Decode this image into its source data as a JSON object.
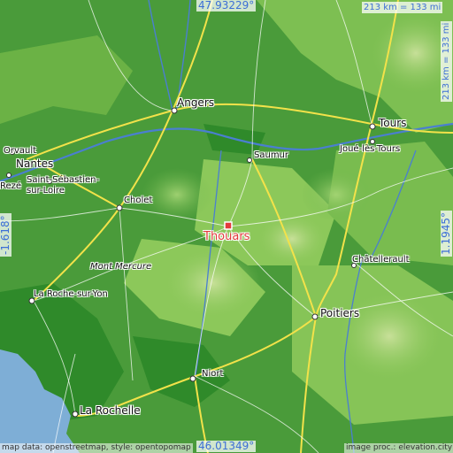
{
  "map": {
    "coordinates": {
      "north": "47.93229°",
      "south": "46.01349°",
      "west": "-1.618°",
      "east": "1.1945°"
    },
    "scale": {
      "horizontal": "213 km = 133 mi",
      "vertical": "213 km = 133 mi"
    },
    "focus_city": "Thouars",
    "places": {
      "angers": "Angers",
      "tours": "Tours",
      "joue_les_tours": "Joué-lès-Tours",
      "saumur": "Saumur",
      "orvault": "Orvault",
      "nantes": "Nantes",
      "reze": "Rezé",
      "saint_sebastien_line1": "Saint-Sébastien-",
      "saint_sebastien_line2": "sur-Loire",
      "cholet": "Cholet",
      "mont_mercure": "Mont Mercure",
      "chatellerault": "Châtellerault",
      "la_roche_sur_yon": "La Roche-sur-Yon",
      "poitiers": "Poitiers",
      "niort": "Niort",
      "la_rochelle": "La Rochelle"
    },
    "footer": {
      "left": "map data: openstreetmap, style: opentopomap",
      "right": "image proc.: elevation.city"
    },
    "colors": {
      "lowland": "#3f9a33",
      "midland": "#8cc85a",
      "upland": "#c8d89a",
      "sea": "#7eaed6",
      "river": "#4a7fd0",
      "road_major": "#f2e24a",
      "road_minor": "#ffffff",
      "city_marker": "#e23b3b",
      "coordinate_text": "#3d6fd6"
    }
  }
}
